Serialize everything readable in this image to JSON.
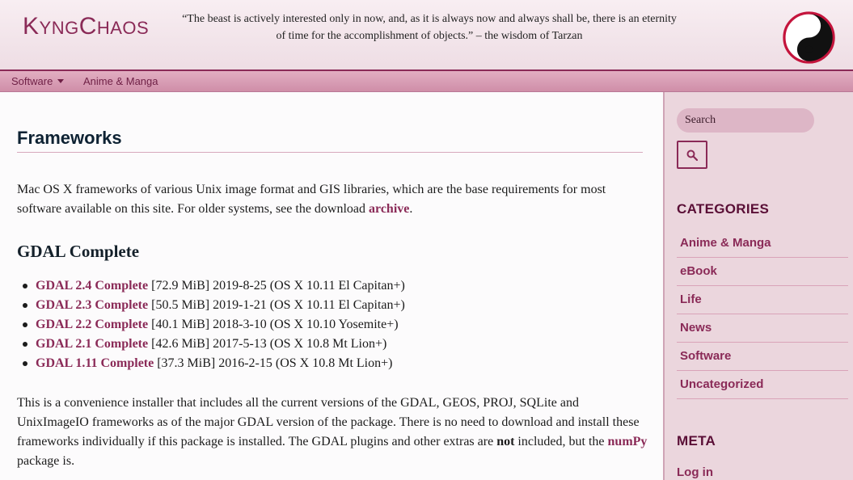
{
  "header": {
    "site_title": "KyngChaos",
    "tagline": "“The beast is actively interested only in now, and, as it is always now and always shall be, there is an eternity of time for the accomplishment of objects.” – the wisdom of Tarzan",
    "logo_icon": "yin-yang-icon"
  },
  "nav": {
    "items": [
      {
        "label": "Software",
        "has_dropdown": true
      },
      {
        "label": "Anime & Manga",
        "has_dropdown": false
      }
    ]
  },
  "main": {
    "title": "Frameworks",
    "intro_text": "Mac OS X frameworks of various Unix image format and GIS libraries, which are the base requirements for most software available on this site. For older systems, see the download ",
    "intro_link": "archive",
    "intro_end": ".",
    "section_heading": "GDAL Complete",
    "downloads": [
      {
        "name": "GDAL 2.4 Complete",
        "details": " [72.9 MiB] 2019-8-25 (OS X 10.11 El Capitan+)"
      },
      {
        "name": "GDAL 2.3 Complete",
        "details": " [50.5 MiB] 2019-1-21 (OS X 10.11 El Capitan+)"
      },
      {
        "name": "GDAL 2.2 Complete",
        "details": " [40.1 MiB] 2018-3-10 (OS X 10.10 Yosemite+)"
      },
      {
        "name": "GDAL 2.1 Complete",
        "details": " [42.6 MiB] 2017-5-13 (OS X 10.8 Mt Lion+)"
      },
      {
        "name": "GDAL 1.11 Complete",
        "details": " [37.3 MiB] 2016-2-15 (OS X 10.8 Mt Lion+)"
      }
    ],
    "desc_text_1": "This is a convenience installer that includes all the current versions of the GDAL, GEOS, PROJ, SQLite and UnixImageIO frameworks as of the major GDAL version of the package. There is no need to download and install these frameworks individually if this package is installed. The GDAL plugins and other extras are ",
    "desc_bold": "not",
    "desc_text_2": " included, but the ",
    "desc_link": "numPy",
    "desc_text_3": " package is."
  },
  "sidebar": {
    "search_placeholder": "Search",
    "search_icon": "magnifier-icon",
    "categories_heading": "CATEGORIES",
    "categories": [
      "Anime & Manga",
      "eBook",
      "Life",
      "News",
      "Software",
      "Uncategorized"
    ],
    "meta_heading": "META",
    "meta_items": [
      "Log in"
    ]
  },
  "colors": {
    "accent": "#8a2a57",
    "nav_bg": "#d89cb3",
    "sidebar_bg": "#ebd6dd"
  }
}
